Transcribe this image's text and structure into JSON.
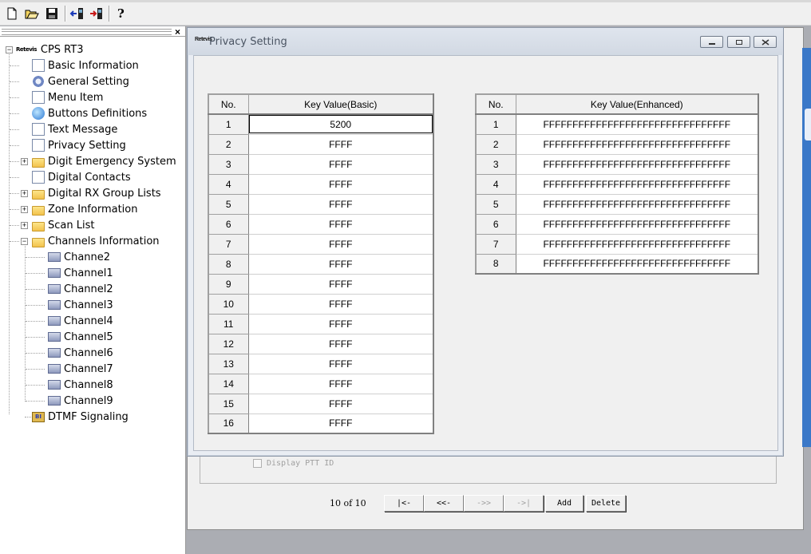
{
  "toolbar": {
    "buttons": [
      "new-icon",
      "open-icon",
      "save-icon",
      "read-radio-icon",
      "write-radio-icon",
      "help-icon"
    ]
  },
  "tree": {
    "root": "CPS RT3",
    "logo_text": "Retevis",
    "items": [
      {
        "label": "Basic Information",
        "icon": "document-icon"
      },
      {
        "label": "General Setting",
        "icon": "gear-icon"
      },
      {
        "label": "Menu Item",
        "icon": "menu-icon"
      },
      {
        "label": "Buttons Definitions",
        "icon": "globe-icon"
      },
      {
        "label": "Text Message",
        "icon": "message-icon"
      },
      {
        "label": "Privacy Setting",
        "icon": "tools-icon"
      },
      {
        "label": "Digit Emergency System",
        "icon": "folder-icon"
      },
      {
        "label": "Digital Contacts",
        "icon": "contact-icon"
      },
      {
        "label": "Digital RX Group Lists",
        "icon": "folder-icon"
      },
      {
        "label": "Zone Information",
        "icon": "folder-icon"
      },
      {
        "label": "Scan List",
        "icon": "folder-icon"
      },
      {
        "label": "Channels Information",
        "icon": "folder-open-icon"
      }
    ],
    "channels": [
      "Channe2",
      "Channel1",
      "Channel2",
      "Channel3",
      "Channel4",
      "Channel5",
      "Channel6",
      "Channel7",
      "Channel8",
      "Channel9"
    ],
    "last_item": "DTMF Signaling",
    "dtmf_icon_text": "BI"
  },
  "main": {
    "checkbox_label": "Display PTT ID",
    "page_info": "10 of 10",
    "nav": {
      "first": "|<-",
      "prev": "<<-",
      "next": "->>",
      "last": "->|",
      "add": "Add",
      "delete": "Delete"
    }
  },
  "dialog": {
    "title": "Privacy Setting",
    "basic_table": {
      "headers": [
        "No.",
        "Key Value(Basic)"
      ],
      "rows": [
        [
          "1",
          "5200"
        ],
        [
          "2",
          "FFFF"
        ],
        [
          "3",
          "FFFF"
        ],
        [
          "4",
          "FFFF"
        ],
        [
          "5",
          "FFFF"
        ],
        [
          "6",
          "FFFF"
        ],
        [
          "7",
          "FFFF"
        ],
        [
          "8",
          "FFFF"
        ],
        [
          "9",
          "FFFF"
        ],
        [
          "10",
          "FFFF"
        ],
        [
          "11",
          "FFFF"
        ],
        [
          "12",
          "FFFF"
        ],
        [
          "13",
          "FFFF"
        ],
        [
          "14",
          "FFFF"
        ],
        [
          "15",
          "FFFF"
        ],
        [
          "16",
          "FFFF"
        ]
      ]
    },
    "enhanced_table": {
      "headers": [
        "No.",
        "Key Value(Enhanced)"
      ],
      "rows": [
        [
          "1",
          "FFFFFFFFFFFFFFFFFFFFFFFFFFFFFFFF"
        ],
        [
          "2",
          "FFFFFFFFFFFFFFFFFFFFFFFFFFFFFFFF"
        ],
        [
          "3",
          "FFFFFFFFFFFFFFFFFFFFFFFFFFFFFFFF"
        ],
        [
          "4",
          "FFFFFFFFFFFFFFFFFFFFFFFFFFFFFFFF"
        ],
        [
          "5",
          "FFFFFFFFFFFFFFFFFFFFFFFFFFFFFFFF"
        ],
        [
          "6",
          "FFFFFFFFFFFFFFFFFFFFFFFFFFFFFFFF"
        ],
        [
          "7",
          "FFFFFFFFFFFFFFFFFFFFFFFFFFFFFFFF"
        ],
        [
          "8",
          "FFFFFFFFFFFFFFFFFFFFFFFFFFFFFFFF"
        ]
      ]
    }
  }
}
